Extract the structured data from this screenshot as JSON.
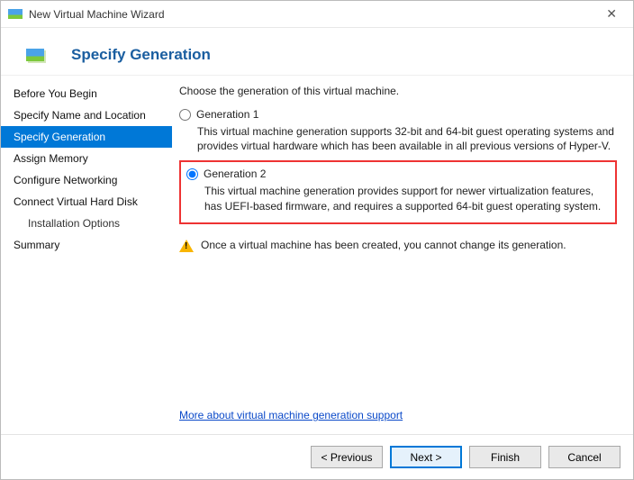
{
  "window": {
    "title": "New Virtual Machine Wizard"
  },
  "header": {
    "title": "Specify Generation"
  },
  "sidebar": {
    "steps": [
      "Before You Begin",
      "Specify Name and Location",
      "Specify Generation",
      "Assign Memory",
      "Configure Networking",
      "Connect Virtual Hard Disk",
      "Installation Options",
      "Summary"
    ]
  },
  "content": {
    "intro": "Choose the generation of this virtual machine.",
    "gen1": {
      "label": "Generation 1",
      "desc": "This virtual machine generation supports 32-bit and 64-bit guest operating systems and provides virtual hardware which has been available in all previous versions of Hyper-V."
    },
    "gen2": {
      "label": "Generation 2",
      "desc": "This virtual machine generation provides support for newer virtualization features, has UEFI-based firmware, and requires a supported 64-bit guest operating system."
    },
    "warning": "Once a virtual machine has been created, you cannot change its generation.",
    "more_link": "More about virtual machine generation support"
  },
  "footer": {
    "previous": "< Previous",
    "next": "Next >",
    "finish": "Finish",
    "cancel": "Cancel"
  }
}
